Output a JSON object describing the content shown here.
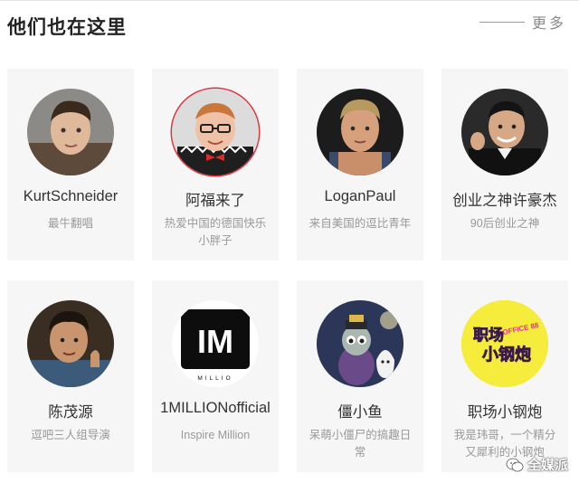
{
  "header": {
    "title": "他们也在这里",
    "more_label": "更多"
  },
  "cards": [
    {
      "name": "KurtSchneider",
      "desc": "最牛翻唱"
    },
    {
      "name": "阿福来了",
      "desc": "热爱中国的德国快乐小胖子"
    },
    {
      "name": "LoganPaul",
      "desc": "来自美国的逗比青年"
    },
    {
      "name": "创业之神许豪杰",
      "desc": "90后创业之神"
    },
    {
      "name": "陈茂源",
      "desc": "逗吧三人组导演"
    },
    {
      "name": "1MILLIONofficial",
      "desc": "Inspire Million",
      "logo_big": "IM",
      "logo_small": "MILLIO"
    },
    {
      "name": "僵小鱼",
      "desc": "呆萌小僵尸的搞趣日常"
    },
    {
      "name": "职场小钢炮",
      "desc": "我是玮哥，一个精分又犀利的小钢炮",
      "logo_top": "职场",
      "logo_bottom": "小钢炮",
      "logo_tag": "OFFICE 88"
    }
  ],
  "watermark": {
    "text": "全媒派"
  },
  "colors": {
    "accent_ring": "#e0303a",
    "card_bg": "#f6f6f6",
    "logo_yellow": "#f5ec3c"
  }
}
